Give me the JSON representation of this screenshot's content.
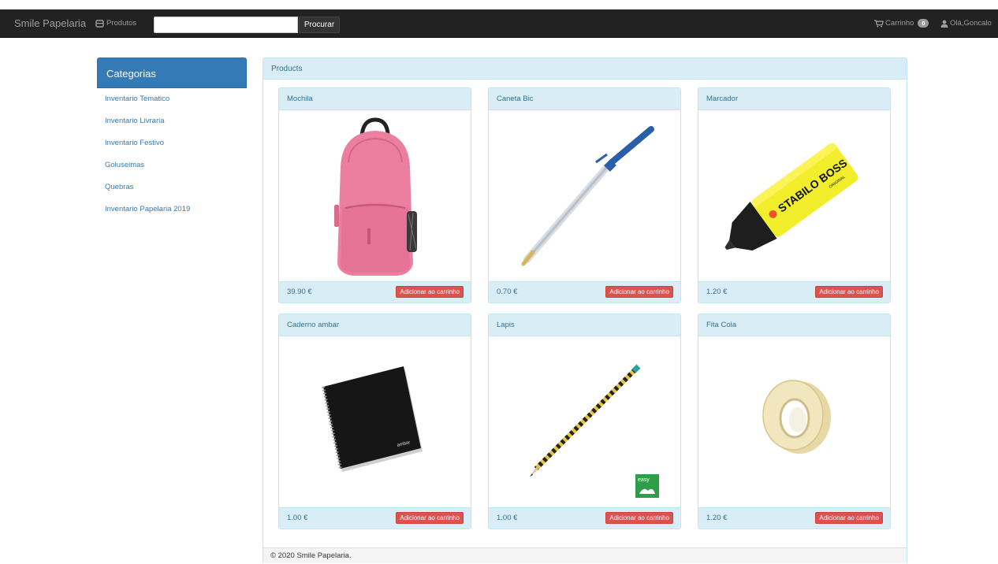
{
  "navbar": {
    "brand": "Smile Papelaria",
    "products_label": "Produtos",
    "search_placeholder": "",
    "search_button": "Procurar",
    "cart_label": "Carrinho",
    "cart_count": "0",
    "user_label": "Olá,Goncalo"
  },
  "sidebar": {
    "title": "Categorias",
    "items": [
      {
        "label": "Inventario Tematico"
      },
      {
        "label": "Inventario Livraria"
      },
      {
        "label": "Inventario Festivo"
      },
      {
        "label": "Goluseimas"
      },
      {
        "label": "Quebras"
      },
      {
        "label": "Inventario Papelaria 2019"
      }
    ]
  },
  "products": {
    "heading": "Products",
    "items": [
      {
        "name": "Mochila",
        "price": "39.90 €",
        "button": "Adicionar ao carrinho",
        "image": "pink-backpack"
      },
      {
        "name": "Caneta Bic",
        "price": "0.70 €",
        "button": "Adicionar ao carrinho",
        "image": "bic-pen"
      },
      {
        "name": "Marcador",
        "price": "1.20 €",
        "button": "Adicionar ao carrinho",
        "image": "highlighter",
        "image_text": "STABILO BOSS",
        "image_subtext": "ORIGINAL"
      },
      {
        "name": "Caderno ambar",
        "price": "1.00 €",
        "button": "Adicionar ao carrinho",
        "image": "black-notebook",
        "image_text": "ambar"
      },
      {
        "name": "Lapis",
        "price": "1.00 €",
        "button": "Adicionar ao carrinho",
        "image": "pencil",
        "image_text": "easy"
      },
      {
        "name": "Fita Cola",
        "price": "1.20 €",
        "button": "Adicionar ao carrinho",
        "image": "tape-roll"
      }
    ]
  },
  "footer": {
    "text": "© 2020 Smile Papelaria."
  },
  "colors": {
    "navbar_bg": "#222222",
    "primary": "#337ab7",
    "info_bg": "#d9edf7",
    "info_border": "#bce8f1",
    "danger": "#d9534f"
  },
  "icons": {
    "products": "inbox-icon",
    "cart": "shopping-cart-icon",
    "user": "user-icon"
  }
}
